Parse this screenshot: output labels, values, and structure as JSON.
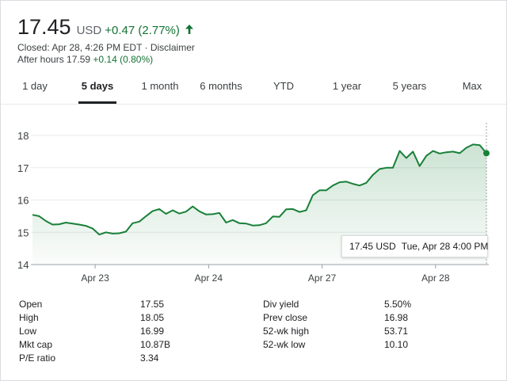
{
  "quote": {
    "price": "17.45",
    "currency": "USD",
    "change": "+0.47 (2.77%)",
    "closed_text": "Closed: Apr 28, 4:26 PM EDT · Disclaimer",
    "after_hours_label": "After hours 17.59",
    "after_hours_change": "+0.14 (0.80%)",
    "up_color": "#137333",
    "arrow_icon": "arrow-up-icon"
  },
  "tabs": [
    {
      "label": "1 day",
      "active": false
    },
    {
      "label": "5 days",
      "active": true
    },
    {
      "label": "1 month",
      "active": false
    },
    {
      "label": "6 months",
      "active": false
    },
    {
      "label": "YTD",
      "active": false
    },
    {
      "label": "1 year",
      "active": false
    },
    {
      "label": "5 years",
      "active": false
    },
    {
      "label": "Max",
      "active": false
    }
  ],
  "chart_data": {
    "type": "area",
    "title": "",
    "xlabel": "",
    "ylabel": "",
    "ylim": [
      14,
      18
    ],
    "yticks": [
      "18",
      "17",
      "16",
      "15",
      "14"
    ],
    "xticks": [
      "Apr 23",
      "Apr 24",
      "Apr 27",
      "Apr 28"
    ],
    "line_color": "#188038",
    "grid": true,
    "series": [
      {
        "values": [
          15.54,
          15.5,
          15.35,
          15.24,
          15.25,
          15.3,
          15.27,
          15.24,
          15.2,
          15.12,
          14.93,
          15.0,
          14.96,
          14.97,
          15.02,
          15.28,
          15.33,
          15.5,
          15.66,
          15.72,
          15.57,
          15.68,
          15.58,
          15.64,
          15.8,
          15.65,
          15.55,
          15.56,
          15.6,
          15.3,
          15.38,
          15.28,
          15.27,
          15.21,
          15.22,
          15.28,
          15.49,
          15.48,
          15.71,
          15.72,
          15.63,
          15.68,
          16.15,
          16.3,
          16.3,
          16.45,
          16.55,
          16.57,
          16.5,
          16.45,
          16.53,
          16.78,
          16.96,
          17.0,
          17.0,
          17.52,
          17.3,
          17.5,
          17.05,
          17.37,
          17.52,
          17.44,
          17.48,
          17.5,
          17.45,
          17.62,
          17.72,
          17.7,
          17.45
        ]
      }
    ]
  },
  "tooltip": {
    "price": "17.45 USD",
    "date": "Tue, Apr 28 4:00 PM"
  },
  "stats": {
    "left": [
      {
        "label": "Open",
        "value": "17.55"
      },
      {
        "label": "High",
        "value": "18.05"
      },
      {
        "label": "Low",
        "value": "16.99"
      },
      {
        "label": "Mkt cap",
        "value": "10.87B"
      },
      {
        "label": "P/E ratio",
        "value": "3.34"
      }
    ],
    "right": [
      {
        "label": "Div yield",
        "value": "5.50%"
      },
      {
        "label": "Prev close",
        "value": "16.98"
      },
      {
        "label": "52-wk high",
        "value": "53.71"
      },
      {
        "label": "52-wk low",
        "value": "10.10"
      }
    ]
  }
}
